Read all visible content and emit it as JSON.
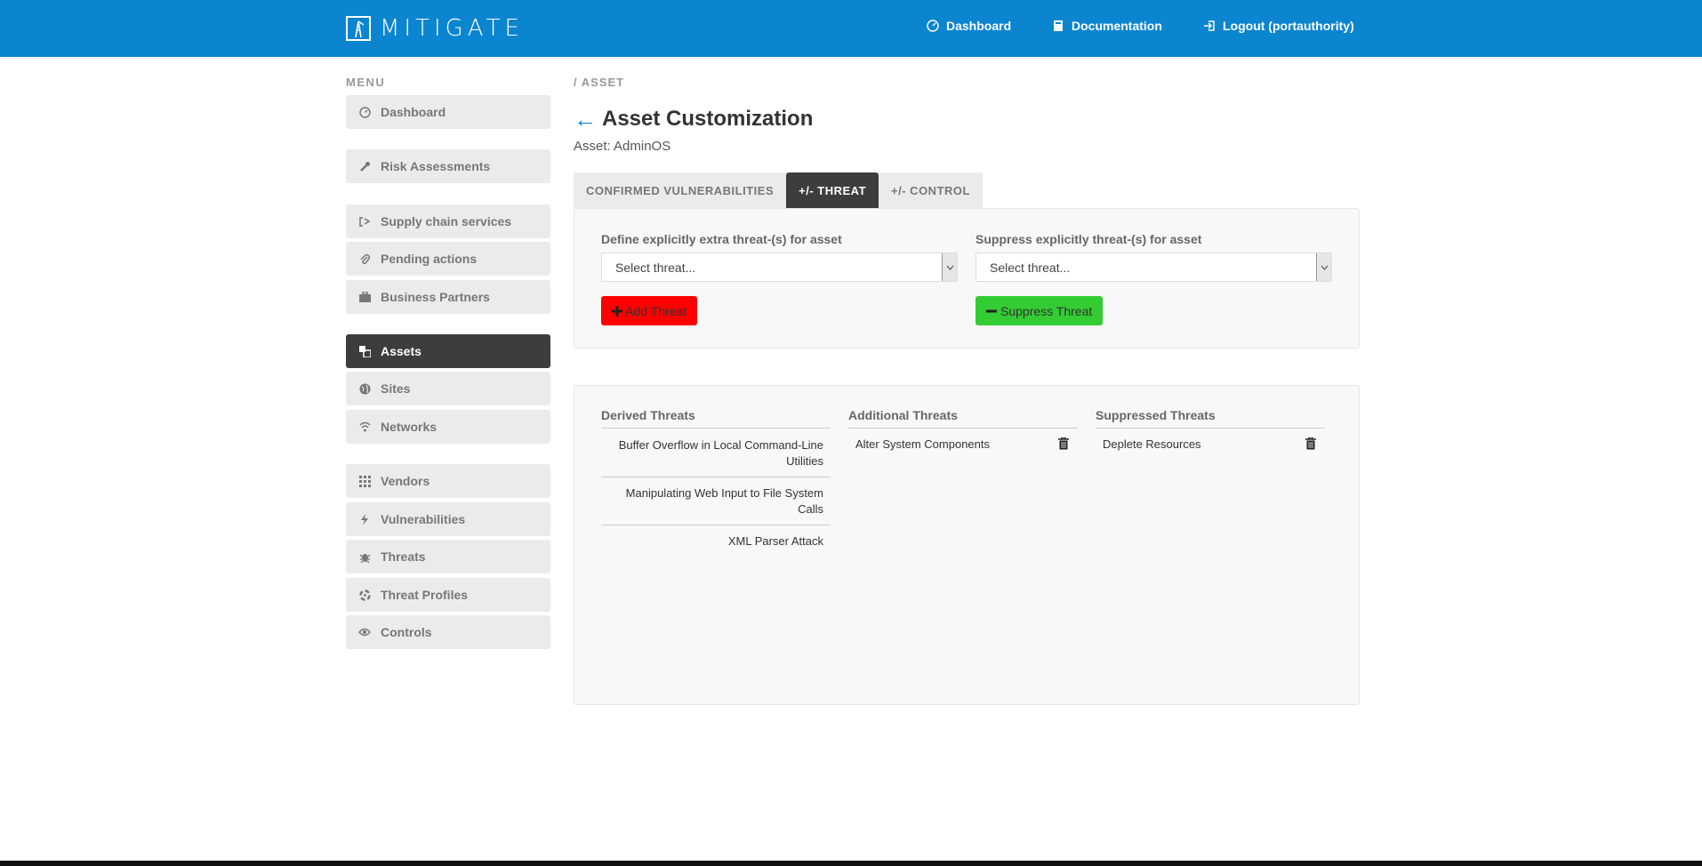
{
  "header": {
    "brand": "MITIGATE",
    "nav": {
      "dashboard": "Dashboard",
      "documentation": "Documentation",
      "logout": "Logout (portauthority)"
    },
    "bg_color": "#0b85cf"
  },
  "sidebar": {
    "menu_label": "MENU",
    "items": [
      {
        "label": "Dashboard",
        "icon": "dashboard-icon"
      },
      {
        "label": "Risk Assessments",
        "icon": "wrench-icon"
      },
      {
        "label": "Supply chain services",
        "icon": "supply-chain-icon"
      },
      {
        "label": "Pending actions",
        "icon": "paperclip-icon"
      },
      {
        "label": "Business Partners",
        "icon": "briefcase-icon"
      },
      {
        "label": "Assets",
        "icon": "assets-icon",
        "active": true
      },
      {
        "label": "Sites",
        "icon": "globe-icon"
      },
      {
        "label": "Networks",
        "icon": "wifi-icon"
      },
      {
        "label": "Vendors",
        "icon": "grid-icon"
      },
      {
        "label": "Vulnerabilities",
        "icon": "bolt-icon"
      },
      {
        "label": "Threats",
        "icon": "bug-icon"
      },
      {
        "label": "Threat Profiles",
        "icon": "biohazard-icon"
      },
      {
        "label": "Controls",
        "icon": "eye-icon"
      }
    ]
  },
  "main": {
    "breadcrumb": "/ ASSET",
    "back_arrow": "←",
    "title": "Asset Customization",
    "asset_label": "Asset: AdminOS",
    "tabs": [
      {
        "label": "CONFIRMED VULNERABILITIES",
        "active": false
      },
      {
        "label": "+/- THREAT",
        "active": true
      },
      {
        "label": "+/- CONTROL",
        "active": false
      }
    ],
    "define_form": {
      "label": "Define explicitly extra threat-(s) for asset",
      "placeholder": "Select threat...",
      "button": "Add Threat",
      "button_color": "#ff0000"
    },
    "suppress_form": {
      "label": "Suppress explicitly threat-(s) for asset",
      "placeholder": "Select threat...",
      "button": "Suppress Threat",
      "button_color": "#33cc33"
    },
    "derived": {
      "heading": "Derived Threats",
      "items": [
        {
          "line1": "Buffer Overflow in Local Command-Line",
          "line2": "Utilities"
        },
        {
          "line1": "Manipulating Web Input to File System",
          "line2": "Calls"
        },
        {
          "line1": "XML Parser Attack",
          "line2": ""
        }
      ]
    },
    "additional": {
      "heading": "Additional Threats",
      "items": [
        "Alter System Components"
      ]
    },
    "suppressed": {
      "heading": "Suppressed Threats",
      "items": [
        "Deplete Resources"
      ]
    }
  }
}
